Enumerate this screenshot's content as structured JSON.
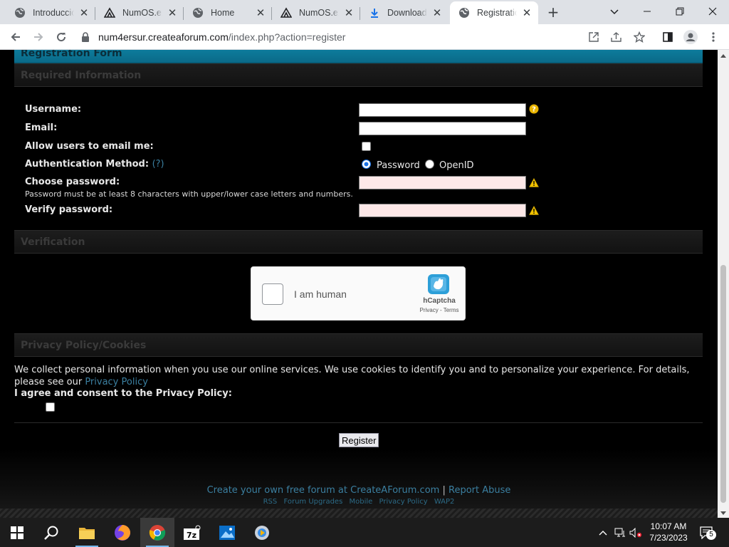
{
  "browser": {
    "tabs": [
      {
        "title": "Introducción",
        "icon": "globe-icon",
        "active": false
      },
      {
        "title": "NumOS.exe",
        "icon": "createaforum-icon",
        "active": false
      },
      {
        "title": "Home",
        "icon": "globe-icon",
        "active": false
      },
      {
        "title": "NumOS.exe",
        "icon": "createaforum-icon",
        "active": false
      },
      {
        "title": "Downloads",
        "icon": "download-icon",
        "active": false
      },
      {
        "title": "Registration",
        "icon": "globe-icon",
        "active": true
      }
    ],
    "url_host": "num4ersur.createaforum.com",
    "url_path": "/index.php?action=register"
  },
  "page": {
    "form_title": "Registration Form",
    "required_header": "Required Information",
    "fields": {
      "username_label": "Username:",
      "email_label": "Email:",
      "allow_email_label": "Allow users to email me:",
      "auth_label": "Authentication Method:",
      "auth_help": "(?)",
      "auth_password": "Password",
      "auth_openid": "OpenID",
      "choose_password_label": "Choose password:",
      "password_hint": "Password must be at least 8 characters with upper/lower case letters and numbers.",
      "verify_password_label": "Verify password:",
      "username_value": "",
      "email_value": "",
      "password_value": "",
      "verify_value": ""
    },
    "verification_header": "Verification",
    "captcha": {
      "label": "I am human",
      "brand": "hCaptcha",
      "links": "Privacy - Terms"
    },
    "privacy_header": "Privacy Policy/Cookies",
    "privacy_text": "We collect personal information when you use our online services. We use cookies to identify you and to personalize your experience. For details, please see our",
    "privacy_link": "Privacy Policy",
    "consent_label": "I agree and consent to the Privacy Policy:",
    "register_button": "Register",
    "footer": {
      "create_link": "Create your own free forum at CreateAForum.com",
      "separator": "|",
      "report_link": "Report Abuse",
      "links": [
        "RSS",
        "Forum Upgrades",
        "Mobile",
        "Privacy Policy",
        "WAP2"
      ]
    }
  },
  "taskbar": {
    "time": "10:07 AM",
    "date": "7/23/2023",
    "notification_count": "5"
  }
}
